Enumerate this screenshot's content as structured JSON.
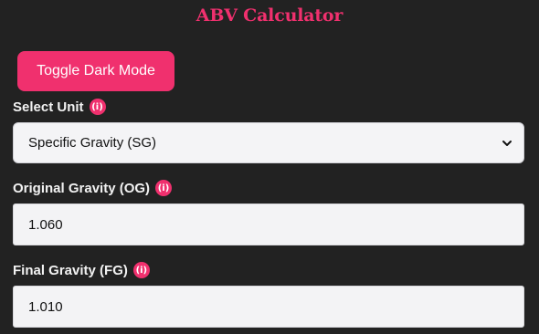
{
  "page": {
    "title": "ABV Calculator"
  },
  "toggle_button": {
    "label": "Toggle Dark Mode"
  },
  "unit": {
    "label": "Select Unit",
    "info_symbol": "(i)",
    "selected": "Specific Gravity (SG)"
  },
  "og": {
    "label": "Original Gravity (OG)",
    "info_symbol": "(i)",
    "value": "1.060"
  },
  "fg": {
    "label": "Final Gravity (FG)",
    "info_symbol": "(i)",
    "value": "1.010"
  },
  "colors": {
    "accent": "#f0306e",
    "background": "#222222",
    "input_background": "#f3f3f5"
  }
}
